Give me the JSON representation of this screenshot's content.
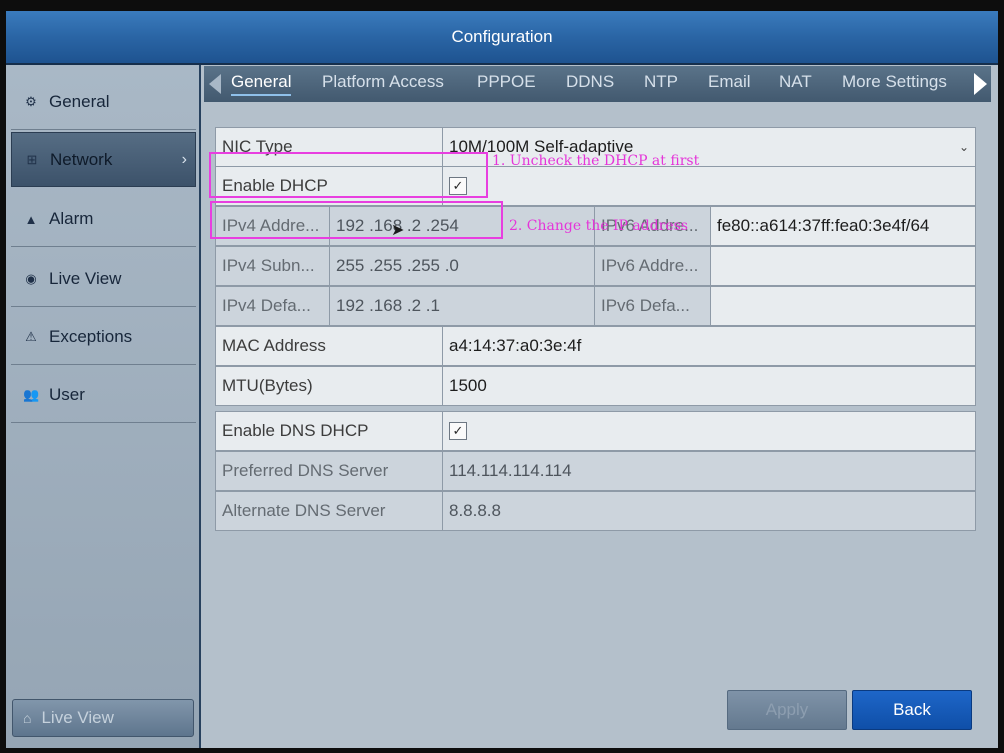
{
  "title": "Configuration",
  "sidebar": {
    "items": [
      {
        "label": "General",
        "icon": "gear-icon",
        "active": false
      },
      {
        "label": "Network",
        "icon": "network-icon",
        "active": true
      },
      {
        "label": "Alarm",
        "icon": "bell-icon",
        "active": false
      },
      {
        "label": "Live View",
        "icon": "eye-icon",
        "active": false
      },
      {
        "label": "Exceptions",
        "icon": "warning-icon",
        "active": false
      },
      {
        "label": "User",
        "icon": "users-icon",
        "active": false
      }
    ],
    "bottom_label": "Live View"
  },
  "tabs": [
    "General",
    "Platform Access",
    "PPPOE",
    "DDNS",
    "NTP",
    "Email",
    "NAT",
    "More Settings"
  ],
  "form": {
    "nic_type_label": "NIC Type",
    "nic_type_value": "10M/100M Self-adaptive",
    "enable_dhcp_label": "Enable DHCP",
    "ipv4_address_label": "IPv4 Addre...",
    "ipv4_address_value": "192 .168 .2    .254",
    "ipv4_subnet_label": "IPv4 Subn...",
    "ipv4_subnet_value": "255 .255 .255 .0",
    "ipv4_gateway_label": "IPv4 Defa...",
    "ipv4_gateway_value": "192 .168 .2    .1",
    "ipv6_address1_label": "IPv6 Addre...",
    "ipv6_address1_value": "fe80::a614:37ff:fea0:3e4f/64",
    "ipv6_address2_label": "IPv6 Addre...",
    "ipv6_gateway_label": "IPv6 Defa...",
    "mac_label": "MAC Address",
    "mac_value": "a4:14:37:a0:3e:4f",
    "mtu_label": "MTU(Bytes)",
    "mtu_value": "1500",
    "enable_dns_dhcp_label": "Enable DNS DHCP",
    "preferred_dns_label": "Preferred DNS Server",
    "preferred_dns_value": "114.114.114.114",
    "alternate_dns_label": "Alternate DNS Server",
    "alternate_dns_value": "8.8.8.8",
    "check_mark": "✓"
  },
  "annotations": {
    "step1": "1. Uncheck the DHCP at first",
    "step2": "2. Change the IP address",
    "color": "#e535d9"
  },
  "buttons": {
    "apply": "Apply",
    "back": "Back"
  }
}
